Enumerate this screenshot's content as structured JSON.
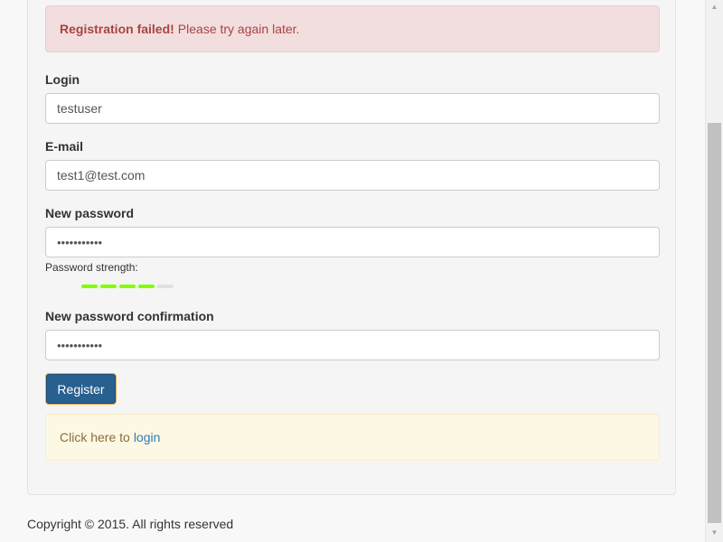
{
  "alerts": {
    "error_strong": "Registration failed!",
    "error_text": "Please try again later.",
    "info_prefix": "Click here to",
    "info_link": "login"
  },
  "form": {
    "login_label": "Login",
    "login_value": "testuser",
    "email_label": "E-mail",
    "email_value": "test1@test.com",
    "password_label": "New password",
    "password_value": "•••••••••••",
    "strength_label": "Password strength:",
    "strength": {
      "filled_segments": 4,
      "total_segments": 5,
      "filled_color": "#80ff00"
    },
    "confirm_label": "New password confirmation",
    "confirm_value": "•••••••••••",
    "submit_label": "Register"
  },
  "footer": {
    "text": "Copyright © 2015. All rights reserved"
  },
  "icons": {
    "scroll_up": "scroll-up-arrow-icon",
    "scroll_down": "scroll-down-arrow-icon"
  }
}
